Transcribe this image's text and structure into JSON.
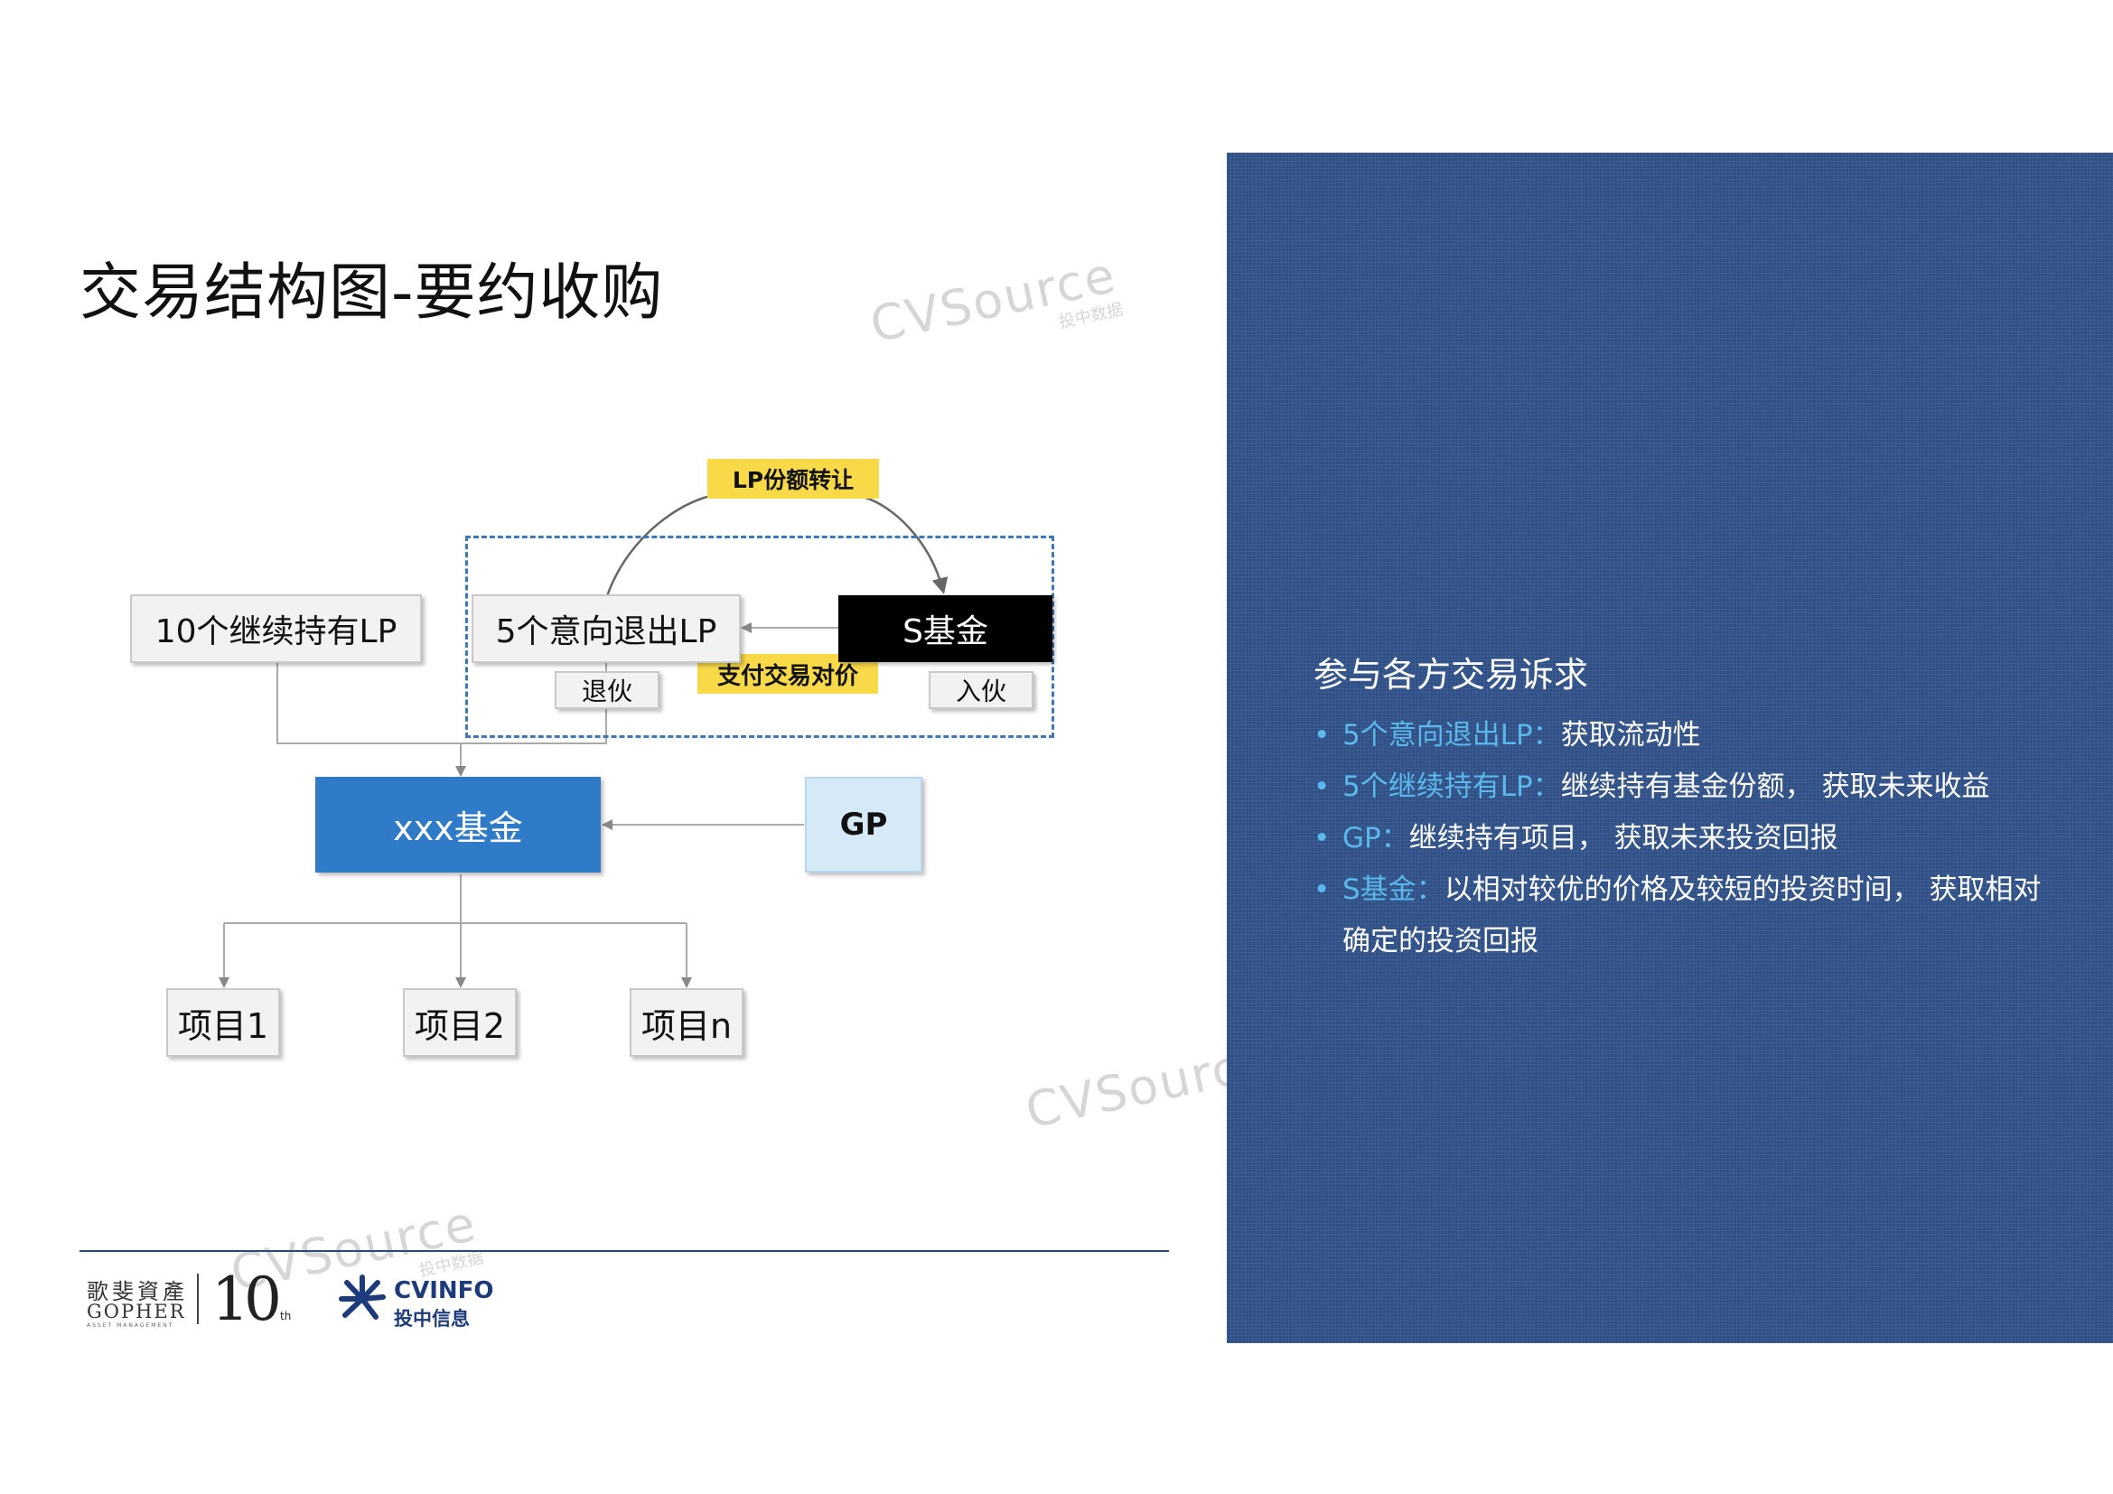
{
  "title": "交易结构图-要约收购",
  "watermark": {
    "text": "CVSource",
    "sub": "投中数据"
  },
  "diagram": {
    "tag_transfer": "LP份额转让",
    "tag_pay": "支付交易对价",
    "lp_continue": "10个继续持有LP",
    "lp_exit": "5个意向退出LP",
    "s_fund": "S基金",
    "exit_label": "退伙",
    "join_label": "入伙",
    "main_fund": "xxx基金",
    "gp": "GP",
    "projects": [
      "项目1",
      "项目2",
      "项目n"
    ]
  },
  "footer": {
    "gopher_cn": "歌斐資產",
    "gopher_en": "GOPHER",
    "gopher_sub": "ASSET MANAGEMENT",
    "anniversary": "10",
    "anniversary_sup": "th",
    "cvinfo_name": "CVINFO",
    "cvinfo_cn": "投中信息"
  },
  "panel": {
    "heading": "参与各方交易诉求",
    "items": [
      {
        "key": "5个意向退出LP：",
        "text": "获取流动性"
      },
      {
        "key": "5个继续持有LP：",
        "text": "继续持有基金份额，  获取未来收益"
      },
      {
        "key": "GP：",
        "text": "继续持有项目，  获取未来投资回报"
      },
      {
        "key": "S基金：",
        "text": "以相对较优的价格及较短的投资时间，  获取相对确定的投资回报"
      }
    ]
  },
  "colors": {
    "panel_bg": "#2f5188",
    "highlight": "#5ab8ea",
    "main_fund": "#2f7bc8",
    "gp_box": "#d6e9f6",
    "s_fund": "#000000",
    "tag": "#f8d947",
    "dash": "#3d78b8"
  }
}
